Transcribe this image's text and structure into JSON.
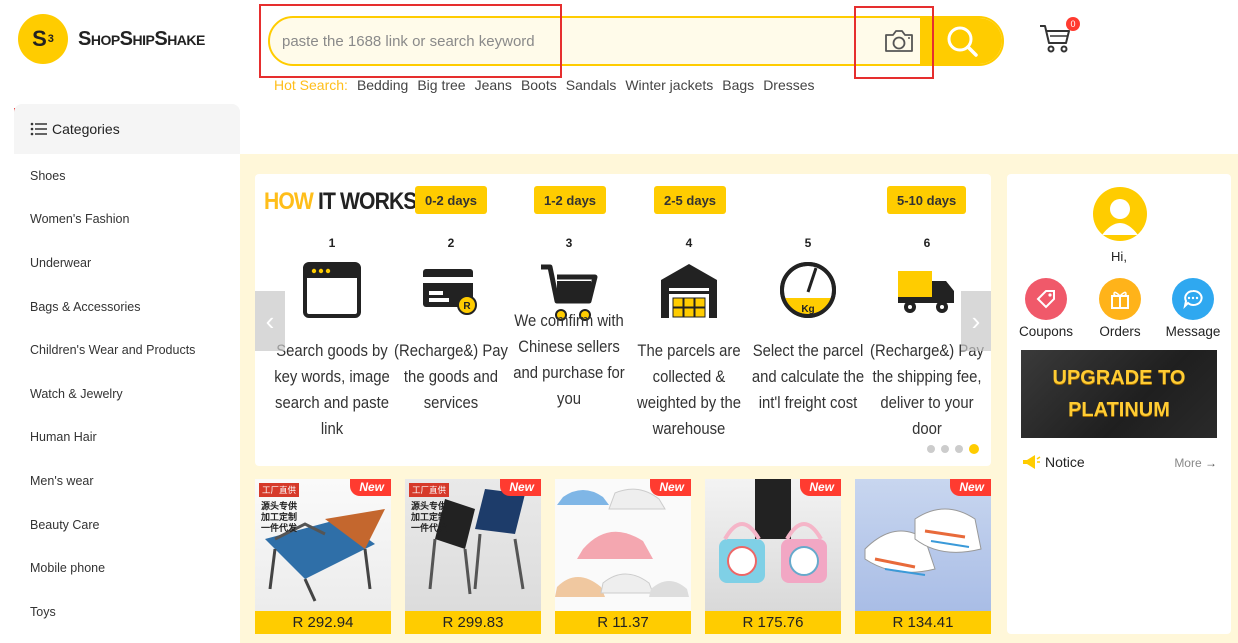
{
  "brand": {
    "logo_mark": "S",
    "logo_sup": "3",
    "name": "ShopShipShake"
  },
  "search": {
    "placeholder": "paste the 1688 link or search keyword",
    "camera_icon": "camera-icon",
    "search_icon": "search-icon"
  },
  "cart": {
    "count": "0"
  },
  "hot_search": {
    "label": "Hot Search:",
    "items": [
      "Bedding",
      "Big tree",
      "Jeans",
      "Boots",
      "Sandals",
      "Winter jackets",
      "Bags",
      "Dresses"
    ]
  },
  "categories": {
    "title": "Categories",
    "items": [
      "Shoes",
      "Women's Fashion",
      "Underwear",
      "Bags & Accessories",
      "Children's Wear and Products",
      "Watch & Jewelry",
      "Human Hair",
      "Men's wear",
      "Beauty Care",
      "Mobile phone",
      "Toys"
    ]
  },
  "how_it_works": {
    "title_highlight": "HOW",
    "title_rest": "IT WORKS",
    "badges": [
      "0-2 days",
      "1-2 days",
      "2-5 days",
      "5-10 days"
    ],
    "steps": [
      {
        "num": "1",
        "text": "Search goods by key words, image search and paste link"
      },
      {
        "num": "2",
        "text": "(Recharge&) Pay the goods and services"
      },
      {
        "num": "3",
        "text": "We comfirm with Chinese sellers and purchase for you"
      },
      {
        "num": "4",
        "text": "The parcels are collected & weighted by the warehouse"
      },
      {
        "num": "5",
        "text": "Select the parcel and calculate the int'l freight cost"
      },
      {
        "num": "6",
        "text": "(Recharge&) Pay the shipping fee, deliver to your door"
      }
    ],
    "kg_label": "Kg",
    "card_currency": "R"
  },
  "products": [
    {
      "price": "R 292.94",
      "tag": "New",
      "factory": "工厂直供",
      "promo": [
        "源头专供",
        "加工定制",
        "一件代发"
      ]
    },
    {
      "price": "R 299.83",
      "tag": "New",
      "factory": "工厂直供",
      "promo": [
        "源头专供",
        "加工定制",
        "一件代发"
      ]
    },
    {
      "price": "R 11.37",
      "tag": "New"
    },
    {
      "price": "R 175.76",
      "tag": "New"
    },
    {
      "price": "R 134.41",
      "tag": "New"
    }
  ],
  "user_panel": {
    "greeting": "Hi,",
    "shortcuts": [
      {
        "label": "Coupons",
        "color": "#f0596a"
      },
      {
        "label": "Orders",
        "color": "#ffb31a"
      },
      {
        "label": "Message",
        "color": "#2fa8f0"
      }
    ],
    "upgrade_line1": "UPGRADE TO",
    "upgrade_line2": "PLATINUM",
    "notice": "Notice",
    "more": "More"
  },
  "colors": {
    "accent": "#ffcc00",
    "hot_label": "#ffbe1a",
    "band": "#fff7d9",
    "highlight_box": "#e62e2e"
  }
}
